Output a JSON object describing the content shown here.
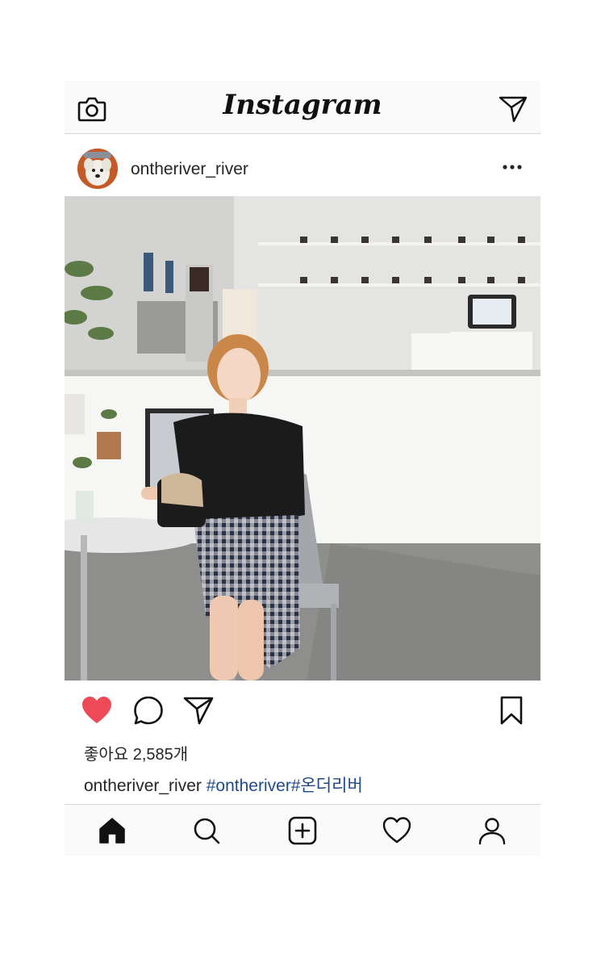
{
  "topbar": {
    "logo_text": "Instagram",
    "camera_icon": "camera-icon",
    "direct_icon": "paper-plane-icon"
  },
  "post": {
    "username": "ontheriver_river",
    "more_icon": "more-horizontal-icon",
    "likes_text": "좋아요 2,585개",
    "caption_user": "ontheriver_river",
    "caption_tags": "#ontheriver#온더리버",
    "liked": true
  },
  "actions": {
    "like_icon": "heart-filled-icon",
    "comment_icon": "comment-icon",
    "share_icon": "paper-plane-icon",
    "save_icon": "bookmark-icon"
  },
  "bottom_nav": {
    "items": [
      "home-icon",
      "search-icon",
      "add-post-icon",
      "activity-heart-icon",
      "profile-icon"
    ]
  },
  "colors": {
    "like_red": "#ed4956",
    "hashtag_blue": "#1f4a8a",
    "bar_bg": "#fafafa",
    "divider": "#d6d6d6"
  }
}
